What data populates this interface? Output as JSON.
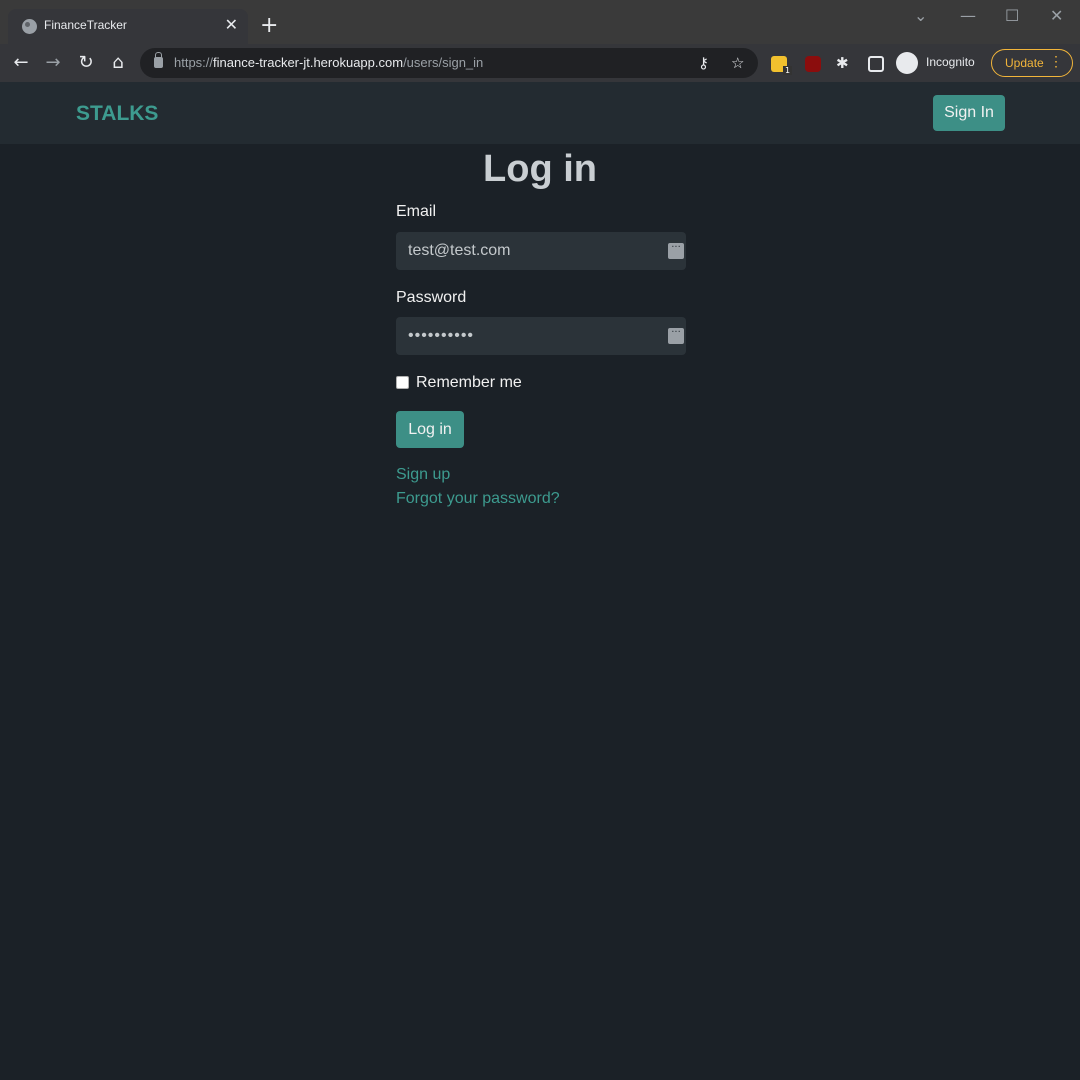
{
  "browser": {
    "tab_title": "FinanceTracker",
    "tab_close": "✕",
    "new_tab": "+",
    "url_scheme": "https://",
    "url_host": "finance-tracker-jt.herokuapp.com",
    "url_path": "/users/sign_in",
    "incognito_label": "Incognito",
    "update_label": "Update",
    "extension_badge": "1"
  },
  "navbar": {
    "brand": "STALKS",
    "sign_in_label": "Sign In"
  },
  "form": {
    "title": "Log in",
    "email_label": "Email",
    "email_value": "test@test.com",
    "password_label": "Password",
    "password_value": "••••••••••",
    "remember_label": "Remember me",
    "submit_label": "Log in"
  },
  "links": {
    "sign_up": "Sign up",
    "forgot_password": "Forgot your password?"
  },
  "colors": {
    "accent": "#3d8f86",
    "background": "#1b2127",
    "update_outline": "#f2b53a"
  }
}
